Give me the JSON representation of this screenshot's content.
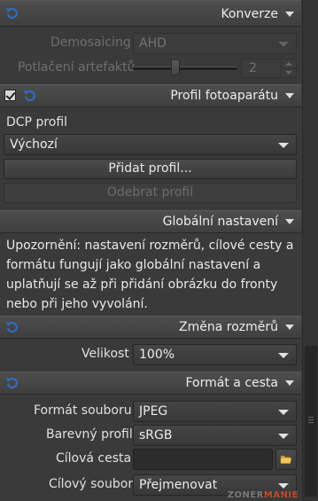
{
  "convert": {
    "title": "Konverze",
    "demosaicing_label": "Demosaicing",
    "demosaicing_value": "AHD",
    "artifacts_label": "Potlačení artefaktů",
    "artifacts_value": "2"
  },
  "camera_profile": {
    "title": "Profil fotoaparátu",
    "dcp_label": "DCP profil",
    "dcp_value": "Výchozí",
    "add_button": "Přidat profil...",
    "remove_button": "Odebrat profil"
  },
  "global": {
    "title": "Globální nastavení",
    "note": "Upozornění: nastavení rozměrů, cílové cesty a formátu fungují jako globální nastavení a uplatňují se až při přidání obrázku do fronty nebo při jeho vyvolání."
  },
  "resize": {
    "title": "Změna rozměrů",
    "size_label": "Velikost",
    "size_value": "100%"
  },
  "format": {
    "title": "Formát a cesta",
    "format_label": "Formát souboru",
    "format_value": "JPEG",
    "color_label": "Barevný profil",
    "color_value": "sRGB",
    "path_label": "Cílová cesta",
    "path_value": "",
    "target_label": "Cílový soubor",
    "target_value": "Přejmenovat"
  },
  "watermark": {
    "part1": "ZONER",
    "part2": "MANIE"
  },
  "colors": {
    "reset_icon": "#2f6fc8",
    "watermark_accent": "#c44a2a"
  }
}
